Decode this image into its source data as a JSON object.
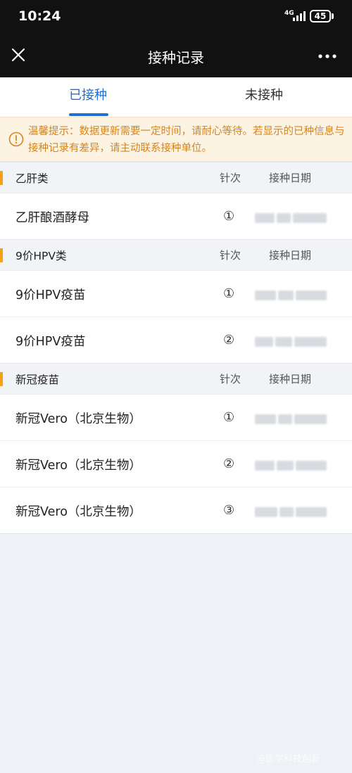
{
  "status_bar": {
    "time": "10:24",
    "network": "4G",
    "battery": "45"
  },
  "header": {
    "title": "接种记录"
  },
  "tabs": [
    {
      "label": "已接种",
      "active": true
    },
    {
      "label": "未接种",
      "active": false
    }
  ],
  "notice": {
    "text": "温馨提示：数据更新需要一定时间，请耐心等待。若显示的已种信息与接种记录有差异，请主动联系接种单位。"
  },
  "columns": {
    "dose": "针次",
    "date": "接种日期"
  },
  "sections": [
    {
      "title": "乙肝类",
      "rows": [
        {
          "name": "乙肝酿酒酵母",
          "dose": "①"
        }
      ]
    },
    {
      "title": "9价HPV类",
      "rows": [
        {
          "name": "9价HPV疫苗",
          "dose": "①"
        },
        {
          "name": "9价HPV疫苗",
          "dose": "②"
        }
      ]
    },
    {
      "title": "新冠疫苗",
      "rows": [
        {
          "name": "新冠Vero（北京生物）",
          "dose": "①"
        },
        {
          "name": "新冠Vero（北京生物）",
          "dose": "②"
        },
        {
          "name": "新冠Vero（北京生物）",
          "dose": "③"
        }
      ]
    }
  ],
  "watermark": "@医学科技创新",
  "colors": {
    "accent": "#1f6fd6",
    "warning": "#d5851d",
    "section_bar": "#f5a113"
  }
}
